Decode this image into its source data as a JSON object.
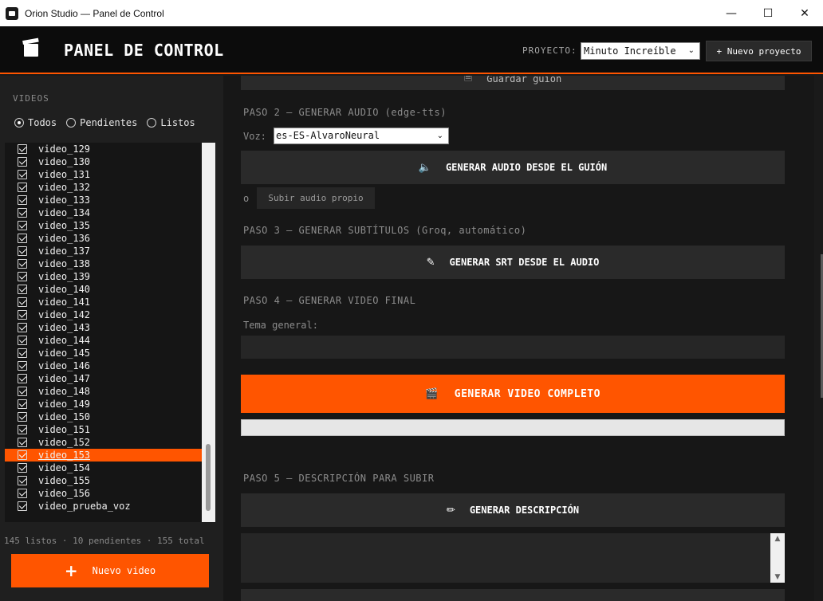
{
  "window": {
    "title": "Orion Studio — Panel de Control",
    "minimize": "—",
    "maximize": "☐",
    "close": "✕"
  },
  "header": {
    "title": "PANEL DE CONTROL",
    "project_label": "PROYECTO:",
    "project_value": "Minuto Increíble",
    "new_project": "+ Nuevo proyecto",
    "accent": "#ff5500"
  },
  "sidebar": {
    "title": "VIDEOS",
    "filters": [
      {
        "label": "Todos",
        "selected": true
      },
      {
        "label": "Pendientes",
        "selected": false
      },
      {
        "label": "Listos",
        "selected": false
      }
    ],
    "videos": [
      "video_129",
      "video_130",
      "video_131",
      "video_132",
      "video_133",
      "video_134",
      "video_135",
      "video_136",
      "video_137",
      "video_138",
      "video_139",
      "video_140",
      "video_141",
      "video_142",
      "video_143",
      "video_144",
      "video_145",
      "video_146",
      "video_147",
      "video_148",
      "video_149",
      "video_150",
      "video_151",
      "video_152",
      "video_153",
      "video_154",
      "video_155",
      "video_156",
      "video_prueba_voz"
    ],
    "selected_video": "video_153",
    "stats": "145 listos · 10 pendientes · 155 total",
    "new_video": "Nuevo video"
  },
  "main": {
    "save_script": "Guardar guión",
    "step2": "PASO 2 — GENERAR AUDIO (edge-tts)",
    "voice_label": "Voz:",
    "voice_value": "es-ES-AlvaroNeural",
    "gen_audio": "GENERAR AUDIO DESDE EL GUIÓN",
    "or_label": "o",
    "upload_audio": "Subir audio propio",
    "step3": "PASO 3 — GENERAR SUBTÍTULOS (Groq, automático)",
    "gen_srt": "GENERAR SRT DESDE EL AUDIO",
    "step4": "PASO 4 — GENERAR VIDEO FINAL",
    "tema_label": "Tema general:",
    "gen_video": "GENERAR VIDEO COMPLETO",
    "progress": 0,
    "step5": "PASO 5 — DESCRIPCIÓN PARA SUBIR",
    "gen_desc": "GENERAR DESCRIPCIÓN"
  }
}
